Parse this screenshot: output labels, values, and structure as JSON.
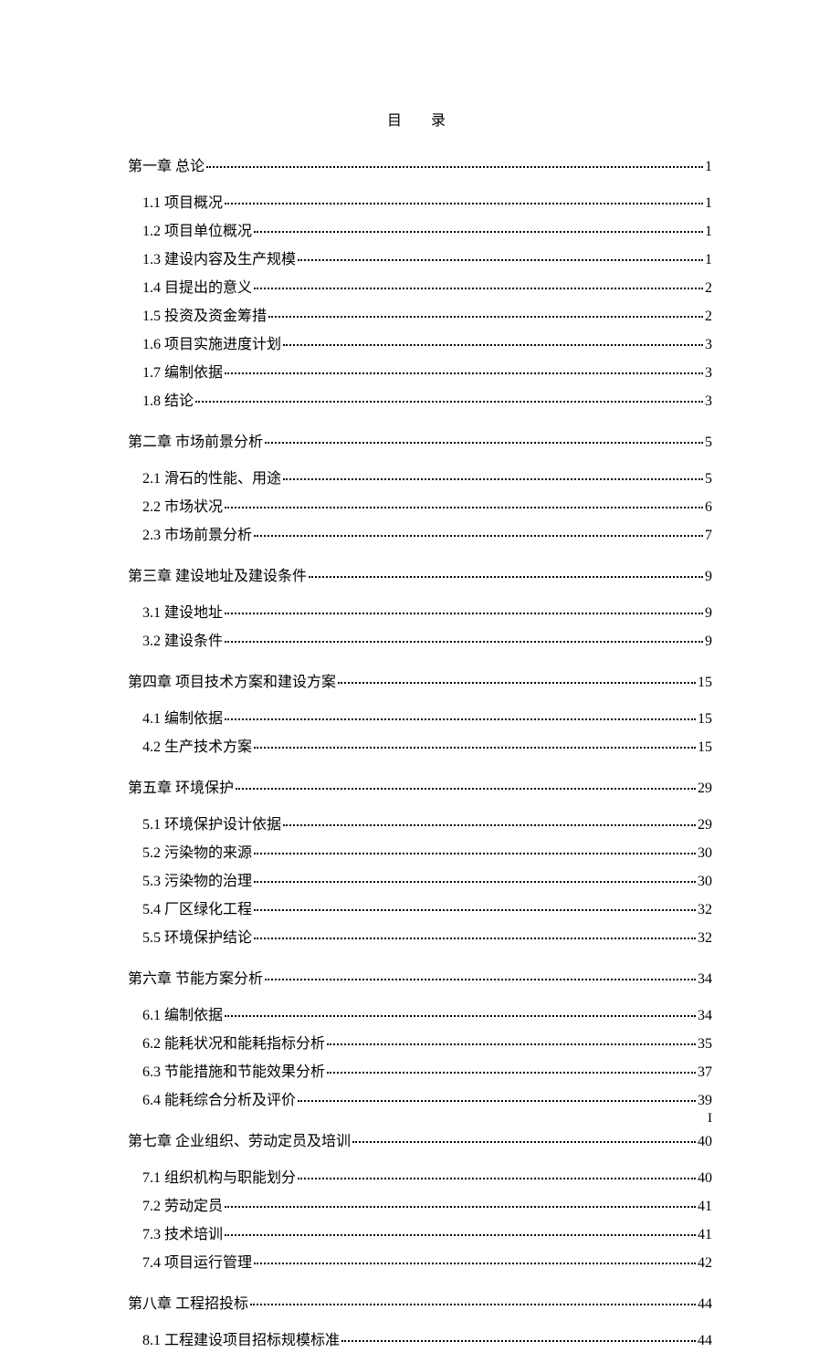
{
  "title": "目　录",
  "page_number": "I",
  "chapters": [
    {
      "label": "第一章  总论",
      "page": "1",
      "subs": [
        {
          "label": "1.1 项目概况",
          "page": "1"
        },
        {
          "label": "1.2 项目单位概况",
          "page": "1"
        },
        {
          "label": "1.3 建设内容及生产规模",
          "page": "1"
        },
        {
          "label": "1.4 目提出的意义",
          "page": "2"
        },
        {
          "label": "1.5 投资及资金筹措",
          "page": "2"
        },
        {
          "label": "1.6 项目实施进度计划",
          "page": "3"
        },
        {
          "label": "1.7 编制依据",
          "page": "3"
        },
        {
          "label": "1.8 结论",
          "page": "3"
        }
      ]
    },
    {
      "label": "第二章  市场前景分析",
      "page": "5",
      "subs": [
        {
          "label": "2.1 滑石的性能、用途",
          "page": "5"
        },
        {
          "label": "2.2 市场状况",
          "page": "6"
        },
        {
          "label": "2.3 市场前景分析",
          "page": "7"
        }
      ]
    },
    {
      "label": "第三章  建设地址及建设条件",
      "page": "9",
      "subs": [
        {
          "label": "3.1  建设地址",
          "page": "9"
        },
        {
          "label": "3.2 建设条件",
          "page": "9"
        }
      ]
    },
    {
      "label": "第四章  项目技术方案和建设方案",
      "page": "15",
      "subs": [
        {
          "label": "4.1 编制依据",
          "page": "15"
        },
        {
          "label": "4.2 生产技术方案",
          "page": "15"
        }
      ]
    },
    {
      "label": "第五章  环境保护",
      "page": "29",
      "subs": [
        {
          "label": "5.1 环境保护设计依据",
          "page": "29"
        },
        {
          "label": "5.2 污染物的来源",
          "page": "30"
        },
        {
          "label": "5.3 污染物的治理",
          "page": "30"
        },
        {
          "label": "5.4 厂区绿化工程",
          "page": "32"
        },
        {
          "label": "5.5  环境保护结论",
          "page": "32"
        }
      ]
    },
    {
      "label": "第六章  节能方案分析",
      "page": "34",
      "subs": [
        {
          "label": "6.1 编制依据",
          "page": "34"
        },
        {
          "label": "6.2 能耗状况和能耗指标分析",
          "page": "35"
        },
        {
          "label": "6.3 节能措施和节能效果分析",
          "page": "37"
        },
        {
          "label": "6.4 能耗综合分析及评价",
          "page": "39"
        }
      ]
    },
    {
      "label": "第七章  企业组织、劳动定员及培训",
      "page": "40",
      "subs": [
        {
          "label": "7.1 组织机构与职能划分",
          "page": "40"
        },
        {
          "label": "7.2 劳动定员",
          "page": "41"
        },
        {
          "label": "7.3 技术培训",
          "page": "41"
        },
        {
          "label": "7.4 项目运行管理",
          "page": "42"
        }
      ]
    },
    {
      "label": "第八章  工程招投标",
      "page": "44",
      "subs": [
        {
          "label": "8.1 工程建设项目招标规模标准",
          "page": "44"
        }
      ]
    }
  ]
}
